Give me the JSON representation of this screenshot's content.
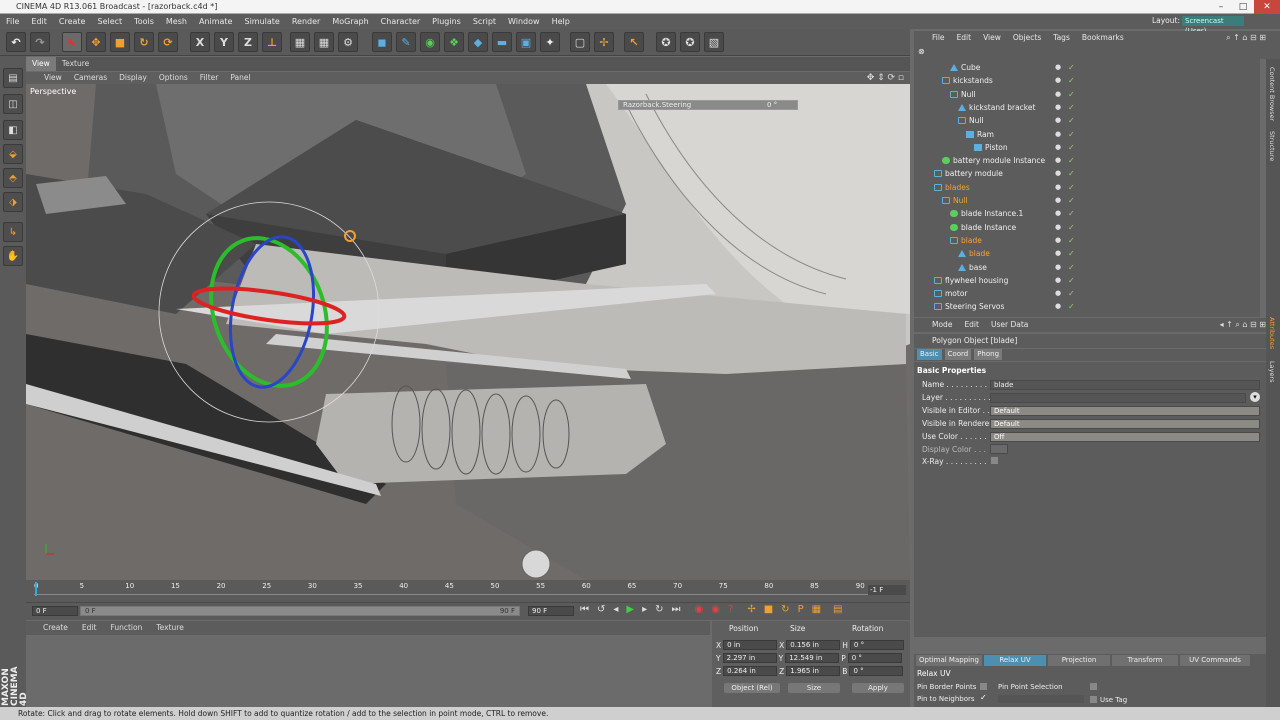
{
  "window": {
    "title": "CINEMA 4D R13.061 Broadcast - [razorback.c4d *]"
  },
  "menubar": {
    "items": [
      "File",
      "Edit",
      "Create",
      "Select",
      "Tools",
      "Mesh",
      "Animate",
      "Simulate",
      "Render",
      "MoGraph",
      "Character",
      "Plugins",
      "Script",
      "Window",
      "Help"
    ],
    "layout_label": "Layout:",
    "layout_value": "Screencast (User)"
  },
  "viewport": {
    "tabs": [
      "View",
      "Texture"
    ],
    "menu": [
      "View",
      "Cameras",
      "Display",
      "Options",
      "Filter",
      "Panel"
    ],
    "label": "Perspective",
    "hud_name": "Razorback.Steering",
    "hud_value": "0 °"
  },
  "timeline": {
    "ticks": [
      "0",
      "5",
      "10",
      "15",
      "20",
      "25",
      "30",
      "35",
      "40",
      "45",
      "50",
      "55",
      "60",
      "65",
      "70",
      "75",
      "80",
      "85",
      "90"
    ],
    "current_frame": "-1 F",
    "start_field": "0 F",
    "range_start": "0 F",
    "range_end": "90 F",
    "end_field": "90 F"
  },
  "material_manager": {
    "menu": [
      "Create",
      "Edit",
      "Function",
      "Texture"
    ]
  },
  "coordinates": {
    "headers": {
      "position": "Position",
      "size": "Size",
      "rotation": "Rotation"
    },
    "rows": [
      {
        "axis": "X",
        "pos": "0 in",
        "size": "0.156 in",
        "rot_axis": "H",
        "rot": "0 °"
      },
      {
        "axis": "Y",
        "pos": "2.297 in",
        "size": "12.549 in",
        "rot_axis": "P",
        "rot": "0 °"
      },
      {
        "axis": "Z",
        "pos": "0.264 in",
        "size": "1.965 in",
        "rot_axis": "B",
        "rot": "0 °"
      }
    ],
    "mode": "Object (Rel)",
    "size_mode": "Size",
    "apply": "Apply"
  },
  "object_manager": {
    "menu": [
      "File",
      "Edit",
      "View",
      "Objects",
      "Tags",
      "Bookmarks"
    ],
    "objects": [
      {
        "name": "Cube",
        "indent": 3,
        "icon": "polygon",
        "selected": false
      },
      {
        "name": "kickstands",
        "indent": 2,
        "icon": "null",
        "selected": false
      },
      {
        "name": "Null",
        "indent": 3,
        "icon": "null",
        "selected": false
      },
      {
        "name": "kickstand bracket",
        "indent": 4,
        "icon": "polygon",
        "selected": false
      },
      {
        "name": "Null",
        "indent": 4,
        "icon": "null",
        "selected": false
      },
      {
        "name": "Ram",
        "indent": 5,
        "icon": "cube",
        "selected": false
      },
      {
        "name": "Piston",
        "indent": 6,
        "icon": "cube",
        "selected": false
      },
      {
        "name": "battery module Instance",
        "indent": 2,
        "icon": "instance",
        "selected": false
      },
      {
        "name": "battery module",
        "indent": 1,
        "icon": "null",
        "selected": false
      },
      {
        "name": "blades",
        "indent": 1,
        "icon": "null",
        "selected": true
      },
      {
        "name": "Null",
        "indent": 2,
        "icon": "null",
        "selected": true
      },
      {
        "name": "blade Instance.1",
        "indent": 3,
        "icon": "instance",
        "selected": false
      },
      {
        "name": "blade Instance",
        "indent": 3,
        "icon": "instance",
        "selected": false
      },
      {
        "name": "blade",
        "indent": 3,
        "icon": "null",
        "selected": true
      },
      {
        "name": "blade",
        "indent": 4,
        "icon": "polygon",
        "selected": true
      },
      {
        "name": "base",
        "indent": 4,
        "icon": "polygon",
        "selected": false
      },
      {
        "name": "flywheel housing",
        "indent": 1,
        "icon": "null",
        "selected": false
      },
      {
        "name": "motor",
        "indent": 1,
        "icon": "null",
        "selected": false
      },
      {
        "name": "Steering Servos",
        "indent": 1,
        "icon": "null",
        "selected": false
      }
    ]
  },
  "attributes": {
    "menu": [
      "Mode",
      "Edit",
      "User Data"
    ],
    "object_title": "Polygon Object [blade]",
    "tabs": [
      "Basic",
      "Coord",
      "Phong"
    ],
    "section": "Basic Properties",
    "fields": [
      {
        "label": "Name . . . . . . . . . .",
        "value": "blade"
      },
      {
        "label": "Layer . . . . . . . . . .",
        "value": ""
      },
      {
        "label": "Visible in Editor . .",
        "value": "Default"
      },
      {
        "label": "Visible in Renderer",
        "value": "Default"
      },
      {
        "label": "Use Color . . . . . .",
        "value": "Off"
      },
      {
        "label": "Display Color . . .",
        "value": ""
      },
      {
        "label": "X-Ray . . . . . . . . .",
        "value": ""
      }
    ]
  },
  "relax_panel": {
    "tabs": [
      "Optimal Mapping",
      "Relax UV",
      "Projection",
      "Transform",
      "UV Commands"
    ],
    "title": "Relax UV",
    "options": [
      {
        "label": "Pin Border Points",
        "checked": false
      },
      {
        "label": "Pin Point Selection",
        "checked": false
      },
      {
        "label": "Pin to Neighbors",
        "checked": true
      },
      {
        "label": "Use Tag",
        "checked": false
      }
    ]
  },
  "side_tabs": [
    "Content Browser",
    "Structure",
    "Attributes",
    "Layers"
  ],
  "branding": "MAXON CINEMA 4D",
  "status": "Rotate: Click and drag to rotate elements. Hold down SHIFT to add to quantize rotation / add to the selection in point mode, CTRL to remove."
}
